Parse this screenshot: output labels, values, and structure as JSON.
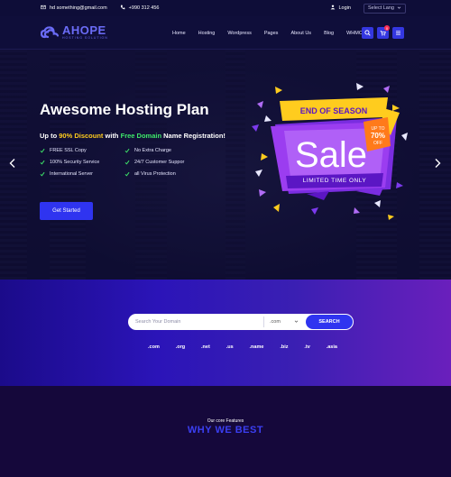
{
  "topbar": {
    "email": "hd something@gmail.com",
    "phone": "+990 312 456",
    "login": "Login",
    "language": "Select Lang",
    "icons": [
      "mail-icon",
      "phone-icon",
      "user-icon",
      "chevron-down-icon"
    ]
  },
  "nav": {
    "logo_name": "AHOPE",
    "logo_tag": "HOSTING SOLUTION",
    "menu": [
      "Home",
      "Hosting",
      "Wordpress",
      "Pages",
      "About Us",
      "Blog",
      "WHMCS"
    ],
    "cart_count": "0",
    "icons": [
      "search-icon",
      "cart-icon",
      "menu-icon"
    ]
  },
  "hero": {
    "title": "Awesome Hosting Plan",
    "subtitle_prefix": "Up to ",
    "subtitle_discount": "90% Discount",
    "subtitle_mid": " with ",
    "subtitle_free": "Free Domain",
    "subtitle_suffix": " Name Registration!",
    "features": [
      "FREE SSL Copy",
      "No Extra Charge",
      "100% Security Service",
      "24/7 Customer Suppor",
      "International Server",
      "all Virus Protection"
    ],
    "cta": "Get Started",
    "sale": {
      "ribbon": "END OF SEASON",
      "word": "Sale",
      "badge_top": "UP TO",
      "badge_value": "70%",
      "badge_bottom": "OFF",
      "footer": "LIMITED TIME ONLY"
    },
    "colors": {
      "accent": "#2f34f0",
      "highlight": "#ffcc1e",
      "green": "#3ee86a"
    }
  },
  "search": {
    "placeholder": "Search Your Domain",
    "select_value": ".com",
    "button": "SEARCH",
    "tlds": [
      ".com",
      ".org",
      ".net",
      ".us",
      ".name",
      ".biz",
      ".tv",
      ".asia"
    ]
  },
  "why": {
    "kicker": "Our core Features",
    "title": "WHY WE BEST"
  }
}
